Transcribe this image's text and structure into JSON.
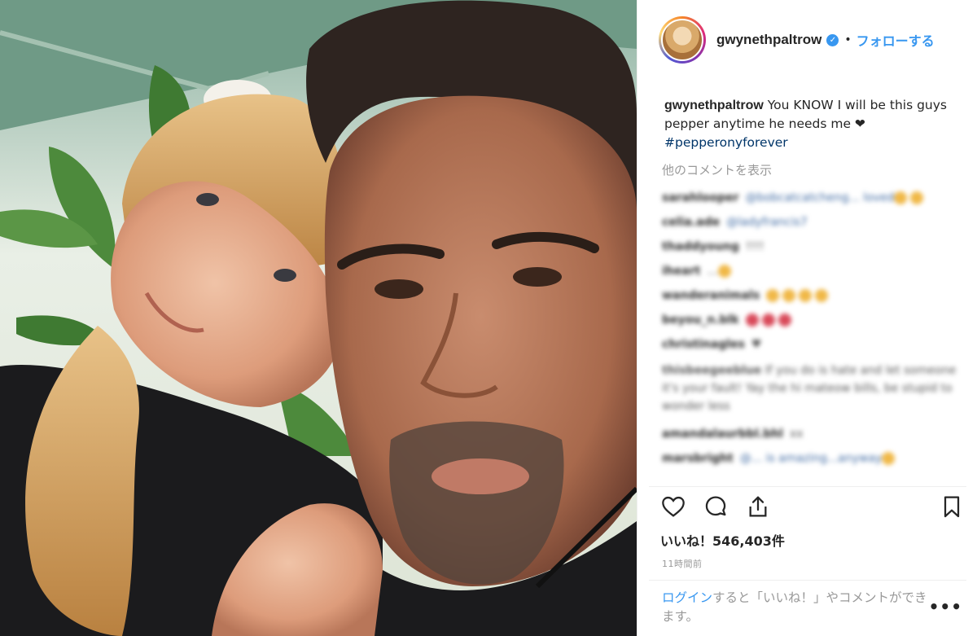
{
  "post": {
    "username": "gwynethpaltrow",
    "verified_icon": "verified-badge-icon",
    "separator": "•",
    "follow_label": "フォローする",
    "caption": {
      "username": "gwynethpaltrow",
      "text": " You KNOW I will be this guys pepper anytime he needs me ",
      "heart": "❤",
      "hashtag": "#pepperonyforever"
    },
    "more_comments_label": "他のコメントを表示",
    "comments": [
      {
        "user": "sarahlooper",
        "text": "@bobcatcatcheng... loved"
      },
      {
        "user": "celia.ade",
        "text": "@ladyfrancis7"
      },
      {
        "user": "thaddyoung",
        "text": "!!!!"
      },
      {
        "user": "iheart",
        "text": "..."
      },
      {
        "user": "wanderanimals",
        "text": ""
      },
      {
        "user": "beyou_n.blk",
        "text": ""
      },
      {
        "user": "christinagles",
        "text": "♥"
      },
      {
        "user": "thisbeegeeblue",
        "text": "If you do is hate and let someone it's your fault! Yay the hi mateow bills, be stupid to wonder less"
      },
      {
        "user": "amandalaurbbl.bhl",
        "text": "xx"
      },
      {
        "user": "marsbright",
        "text": "@... is amazing...anyway"
      }
    ],
    "likes_label": "いいね！546,403件",
    "timestamp": "11時間前",
    "login_prompt": {
      "link": "ログイン",
      "text": "すると「いいね！」やコメントができます。"
    },
    "more_options": "•••",
    "icons": {
      "like": "heart-icon",
      "comment": "comment-icon",
      "share": "share-icon",
      "save": "bookmark-icon"
    }
  },
  "colors": {
    "accent": "#3897f0",
    "hashtag": "#003569",
    "muted": "#999999",
    "text": "#262626"
  }
}
